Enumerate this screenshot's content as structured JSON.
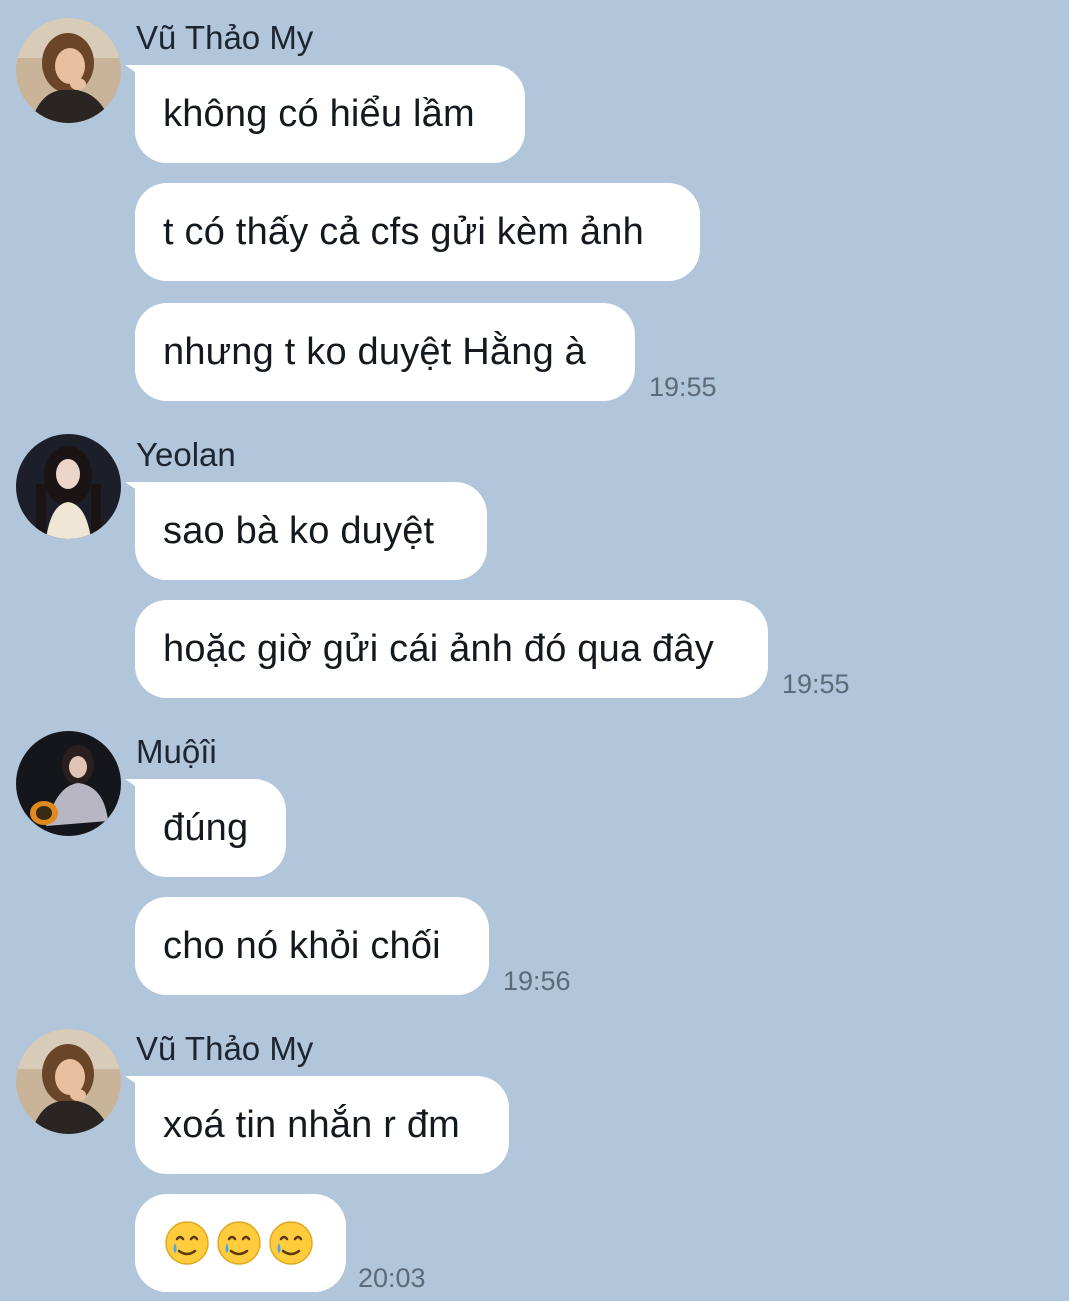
{
  "groups": [
    {
      "sender": "Vũ Thảo My",
      "avatar": "avatar-vu-thao-my",
      "messages": [
        "không có hiểu lầm",
        "t có thấy cả cfs gửi kèm ảnh",
        "nhưng t ko duyệt Hằng à"
      ],
      "time": "19:55"
    },
    {
      "sender": "Yeolan",
      "avatar": "avatar-yeolan",
      "messages": [
        "sao bà ko duyệt",
        "hoặc giờ gửi cái ảnh đó qua đây"
      ],
      "time": "19:55"
    },
    {
      "sender": "Muộîi",
      "avatar": "avatar-muoii",
      "messages": [
        "đúng",
        "cho nó khỏi chối"
      ],
      "time": "19:56"
    },
    {
      "sender": "Vũ Thảo My",
      "avatar": "avatar-vu-thao-my",
      "messages": [
        "xoá tin nhắn r đm",
        "🥲🥲🥲"
      ],
      "emoji": [
        "smiling-face-with-tear-icon",
        "smiling-face-with-tear-icon",
        "smiling-face-with-tear-icon"
      ],
      "time": "20:03"
    }
  ],
  "colors": {
    "background": "#b1c6da",
    "bubble": "#ffffff",
    "text": "#14191f",
    "timestamp": "#5c6b7a"
  }
}
